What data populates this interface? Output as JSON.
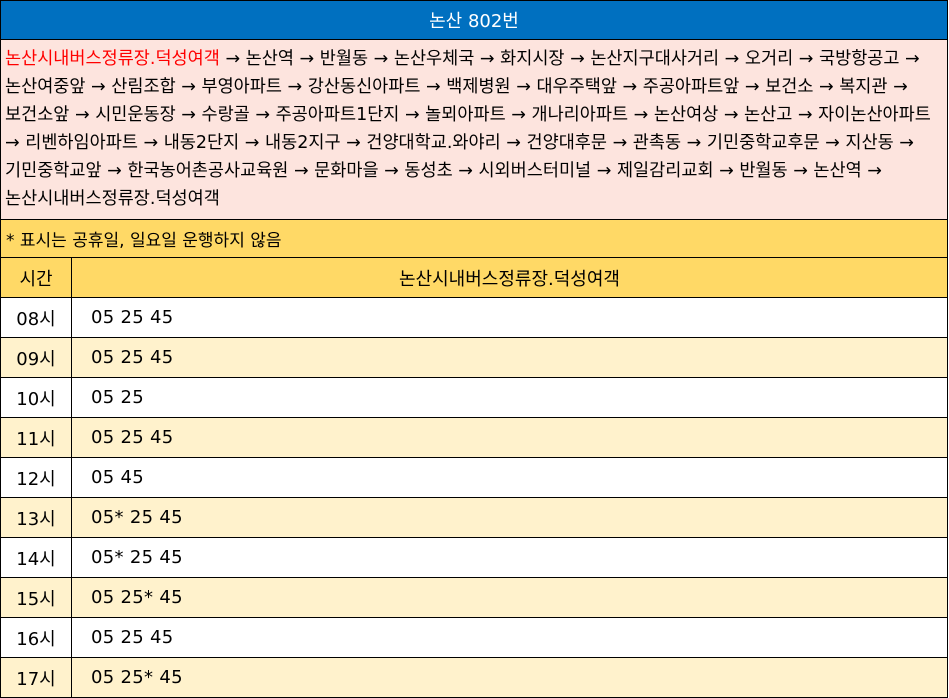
{
  "title": "논산 802번",
  "route": {
    "start": "논산시내버스정류장.덕성여객",
    "rest": " → 논산역 → 반월동 → 논산우체국 → 화지시장 → 논산지구대사거리 → 오거리 → 국방항공고 → 논산여중앞 → 산림조합 → 부영아파트 → 강산동신아파트 → 백제병원 → 대우주택앞 → 주공아파트앞 → 보건소 → 복지관 → 보건소앞 → 시민운동장 → 수랑골 → 주공아파트1단지 → 놀뫼아파트 → 개나리아파트 → 논산여상 → 논산고 → 자이논산아파트 → 리벤하임아파트 → 내동2단지 → 내동2지구 → 건양대학교.와야리 → 건양대후문 → 관촉동 → 기민중학교후문 → 지산동 → 기민중학교앞 → 한국농어촌공사교육원 → 문화마을 → 동성초 → 시외버스터미널 → 제일감리교회 → 반월동 → 논산역 → 논산시내버스정류장.덕성여객"
  },
  "note": "* 표시는 공휴일, 일요일 운행하지 않음",
  "table": {
    "headers": [
      "시간",
      "논산시내버스정류장.덕성여객"
    ],
    "rows": [
      {
        "hour": "08시",
        "times": "05 25 45"
      },
      {
        "hour": "09시",
        "times": "05 25 45"
      },
      {
        "hour": "10시",
        "times": "05 25"
      },
      {
        "hour": "11시",
        "times": "05 25 45"
      },
      {
        "hour": "12시",
        "times": "05 45"
      },
      {
        "hour": "13시",
        "times": "05* 25 45"
      },
      {
        "hour": "14시",
        "times": "05* 25 45"
      },
      {
        "hour": "15시",
        "times": "05 25* 45"
      },
      {
        "hour": "16시",
        "times": "05 25 45"
      },
      {
        "hour": "17시",
        "times": "05 25* 45"
      }
    ]
  },
  "colors": {
    "title_bg": "#0070c0",
    "route_bg": "#fde4de",
    "route_start": "#ff0000",
    "header_bg": "#ffd966",
    "alt_row_bg": "#fff2cc"
  }
}
